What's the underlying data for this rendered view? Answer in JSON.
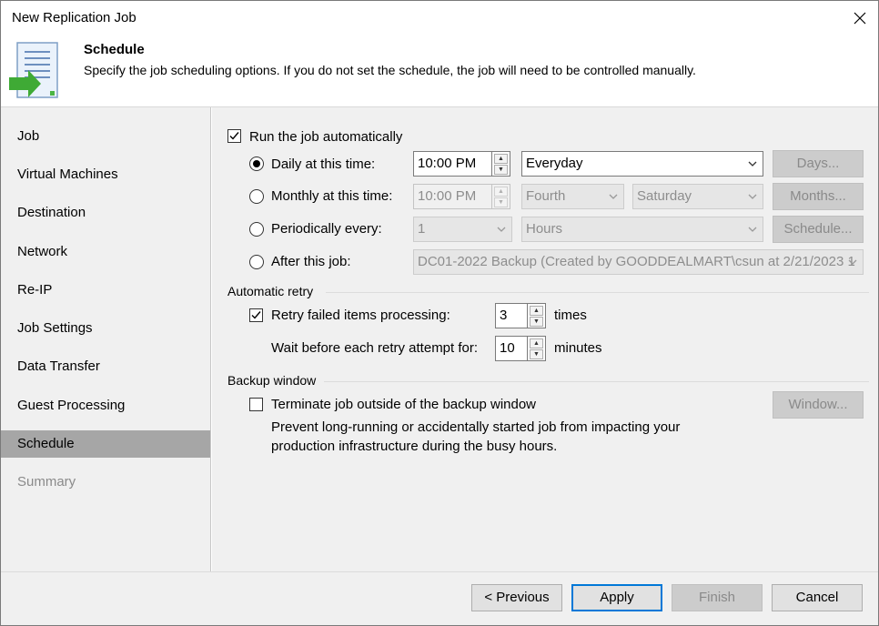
{
  "window": {
    "title": "New Replication Job"
  },
  "header": {
    "title": "Schedule",
    "description": "Specify the job scheduling options. If you do not set the schedule, the job will need to be controlled manually."
  },
  "sidebar": {
    "items": [
      {
        "label": "Job"
      },
      {
        "label": "Virtual Machines"
      },
      {
        "label": "Destination"
      },
      {
        "label": "Network"
      },
      {
        "label": "Re-IP"
      },
      {
        "label": "Job Settings"
      },
      {
        "label": "Data Transfer"
      },
      {
        "label": "Guest Processing"
      },
      {
        "label": "Schedule"
      },
      {
        "label": "Summary"
      }
    ],
    "active_index": 8
  },
  "schedule": {
    "run_automatically": {
      "label": "Run the job automatically",
      "checked": true
    },
    "daily": {
      "label": "Daily at this time:",
      "time": "10:00 PM",
      "frequency": "Everyday",
      "button": "Days..."
    },
    "monthly": {
      "label": "Monthly at this time:",
      "time": "10:00 PM",
      "week": "Fourth",
      "day": "Saturday",
      "button": "Months..."
    },
    "periodically": {
      "label": "Periodically every:",
      "value": "1",
      "unit": "Hours",
      "button": "Schedule..."
    },
    "after_job": {
      "label": "After this job:",
      "value": "DC01-2022 Backup (Created by GOODDEALMART\\csun at 2/21/2023 1"
    }
  },
  "retry": {
    "group_label": "Automatic retry",
    "retry_label": "Retry failed items processing:",
    "retry_checked": true,
    "retry_count": "3",
    "times_label": "times",
    "wait_label": "Wait before each retry attempt for:",
    "wait_value": "10",
    "minutes_label": "minutes"
  },
  "backup_window": {
    "group_label": "Backup window",
    "terminate_label": "Terminate job outside of the backup window",
    "terminate_checked": false,
    "description_line1": "Prevent long-running or accidentally started job from impacting your",
    "description_line2": "production infrastructure during the busy hours.",
    "button": "Window..."
  },
  "footer": {
    "previous": "< Previous",
    "apply": "Apply",
    "finish": "Finish",
    "cancel": "Cancel"
  },
  "colors": {
    "accent": "#0078d7",
    "active_nav": "#a6a6a6",
    "panel_bg": "#f0f0f0"
  }
}
